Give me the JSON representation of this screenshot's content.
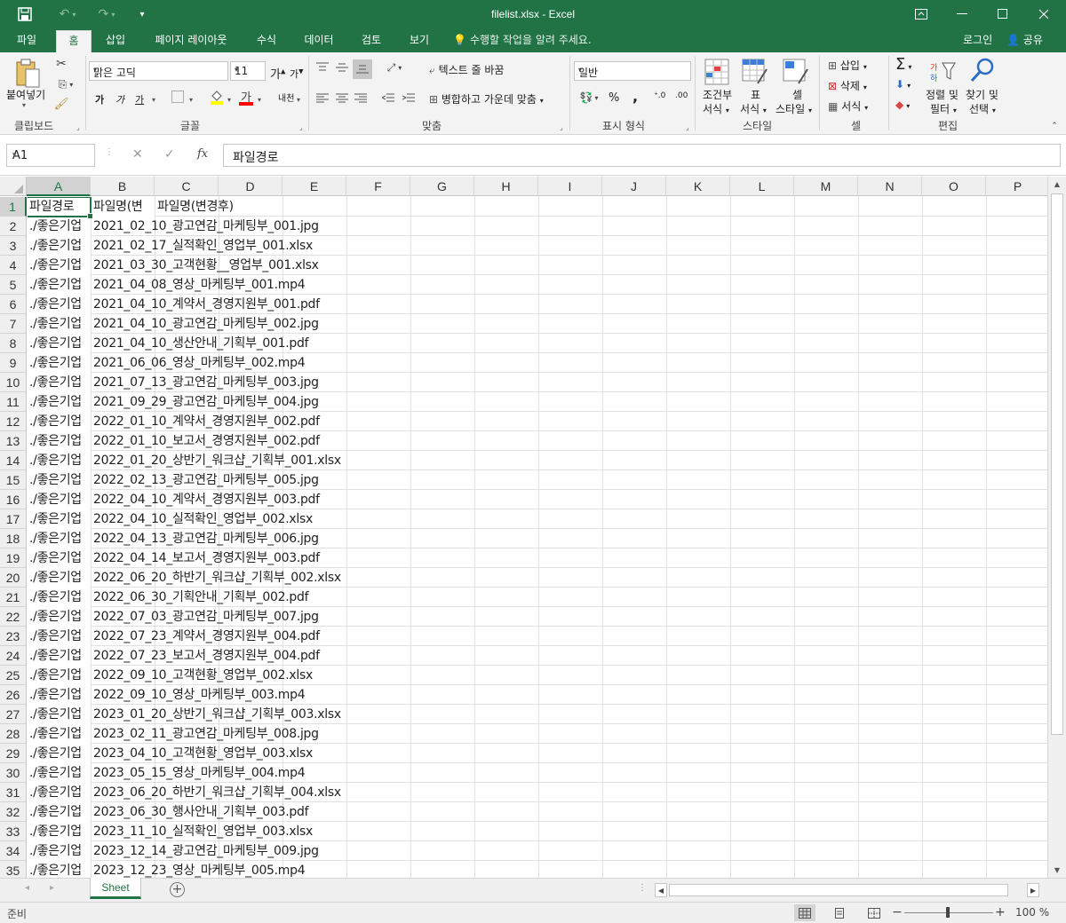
{
  "window": {
    "title": "filelist.xlsx - Excel",
    "minimize_icon": "minimize-icon",
    "maximize_icon": "maximize-icon",
    "close_icon": "close-icon"
  },
  "tabs": [
    "파일",
    "홈",
    "삽입",
    "페이지 레이아웃",
    "수식",
    "데이터",
    "검토",
    "보기"
  ],
  "active_tab": "홈",
  "tell_me": "수행할 작업을 알려 주세요.",
  "account": {
    "login": "로그인",
    "share": "공유"
  },
  "ribbon": {
    "clipboard": {
      "paste": "붙여넣기",
      "label": "클립보드"
    },
    "font": {
      "name": "맑은 고딕",
      "size": "11",
      "bold": "가",
      "italic": "가",
      "underline": "가",
      "grow": "가",
      "shrink": "가",
      "font_color": "가",
      "phonetic": "내천",
      "label": "글꼴"
    },
    "alignment": {
      "wrap": "텍스트 줄 바꿈",
      "merge": "병합하고 가운데 맞춤",
      "label": "맞춤"
    },
    "number": {
      "format": "일반",
      "percent": "%",
      "comma": ",",
      "label": "표시 형식"
    },
    "styles": {
      "conditional": "조건부",
      "conditional2": "서식",
      "table": "표",
      "table2": "서식",
      "cell": "셀",
      "cell2": "스타일",
      "label": "스타일"
    },
    "cells": {
      "insert": "삽입",
      "delete": "삭제",
      "format": "서식",
      "label": "셀"
    },
    "editing": {
      "sort": "정렬 및",
      "sort2": "필터",
      "find": "찾기 및",
      "find2": "선택",
      "label": "편집"
    }
  },
  "formula_bar": {
    "name_box": "A1",
    "fx": "fx",
    "content": "파일경로"
  },
  "columns": [
    "A",
    "B",
    "C",
    "D",
    "E",
    "F",
    "G",
    "H",
    "I",
    "J",
    "K",
    "L",
    "M",
    "N",
    "O",
    "P"
  ],
  "selected_column": "A",
  "header_row": {
    "a": "파일경로",
    "b": "파일명(변",
    "c": "파일명(변경후)"
  },
  "rows": [
    {
      "n": "2",
      "a": "./좋은기업",
      "b": "2021_02_10_광고연감_마케팅부_001.jpg"
    },
    {
      "n": "3",
      "a": "./좋은기업",
      "b": "2021_02_17_실적확인_영업부_001.xlsx"
    },
    {
      "n": "4",
      "a": "./좋은기업",
      "b": "2021_03_30_고객현황__영업부_001.xlsx"
    },
    {
      "n": "5",
      "a": "./좋은기업",
      "b": "2021_04_08_영상_마케팅부_001.mp4"
    },
    {
      "n": "6",
      "a": "./좋은기업",
      "b": "2021_04_10_계약서_경영지원부_001.pdf"
    },
    {
      "n": "7",
      "a": "./좋은기업",
      "b": "2021_04_10_광고연감_마케팅부_002.jpg"
    },
    {
      "n": "8",
      "a": "./좋은기업",
      "b": "2021_04_10_생산안내_기획부_001.pdf"
    },
    {
      "n": "9",
      "a": "./좋은기업",
      "b": "2021_06_06_영상_마케팅부_002.mp4"
    },
    {
      "n": "10",
      "a": "./좋은기업",
      "b": "2021_07_13_광고연감_마케팅부_003.jpg"
    },
    {
      "n": "11",
      "a": "./좋은기업",
      "b": "2021_09_29_광고연감_마케팅부_004.jpg"
    },
    {
      "n": "12",
      "a": "./좋은기업",
      "b": "2022_01_10_계약서_경영지원부_002.pdf"
    },
    {
      "n": "13",
      "a": "./좋은기업",
      "b": "2022_01_10_보고서_경영지원부_002.pdf"
    },
    {
      "n": "14",
      "a": "./좋은기업",
      "b": "2022_01_20_상반기_워크샵_기획부_001.xlsx"
    },
    {
      "n": "15",
      "a": "./좋은기업",
      "b": "2022_02_13_광고연감_마케팅부_005.jpg"
    },
    {
      "n": "16",
      "a": "./좋은기업",
      "b": "2022_04_10_계약서_경영지원부_003.pdf"
    },
    {
      "n": "17",
      "a": "./좋은기업",
      "b": "2022_04_10_실적확인_영업부_002.xlsx"
    },
    {
      "n": "18",
      "a": "./좋은기업",
      "b": "2022_04_13_광고연감_마케팅부_006.jpg"
    },
    {
      "n": "19",
      "a": "./좋은기업",
      "b": "2022_04_14_보고서_경영지원부_003.pdf"
    },
    {
      "n": "20",
      "a": "./좋은기업",
      "b": "2022_06_20_하반기_워크샵_기획부_002.xlsx"
    },
    {
      "n": "21",
      "a": "./좋은기업",
      "b": "2022_06_30_기획안내_기획부_002.pdf"
    },
    {
      "n": "22",
      "a": "./좋은기업",
      "b": "2022_07_03_광고연감_마케팅부_007.jpg"
    },
    {
      "n": "23",
      "a": "./좋은기업",
      "b": "2022_07_23_계약서_경영지원부_004.pdf"
    },
    {
      "n": "24",
      "a": "./좋은기업",
      "b": "2022_07_23_보고서_경영지원부_004.pdf"
    },
    {
      "n": "25",
      "a": "./좋은기업",
      "b": "2022_09_10_고객현황_영업부_002.xlsx"
    },
    {
      "n": "26",
      "a": "./좋은기업",
      "b": "2022_09_10_영상_마케팅부_003.mp4"
    },
    {
      "n": "27",
      "a": "./좋은기업",
      "b": "2023_01_20_상반기_워크샵_기획부_003.xlsx"
    },
    {
      "n": "28",
      "a": "./좋은기업",
      "b": "2023_02_11_광고연감_마케팅부_008.jpg"
    },
    {
      "n": "29",
      "a": "./좋은기업",
      "b": "2023_04_10_고객현황_영업부_003.xlsx"
    },
    {
      "n": "30",
      "a": "./좋은기업",
      "b": "2023_05_15_영상_마케팅부_004.mp4"
    },
    {
      "n": "31",
      "a": "./좋은기업",
      "b": "2023_06_20_하반기_워크샵_기획부_004.xlsx"
    },
    {
      "n": "32",
      "a": "./좋은기업",
      "b": "2023_06_30_행사안내_기획부_003.pdf"
    },
    {
      "n": "33",
      "a": "./좋은기업",
      "b": "2023_11_10_실적확인_영업부_003.xlsx"
    },
    {
      "n": "34",
      "a": "./좋은기업",
      "b": "2023_12_14_광고연감_마케팅부_009.jpg"
    },
    {
      "n": "35",
      "a": "./좋은기업",
      "b": "2023_12_23_영상_마케팅부_005.mp4"
    }
  ],
  "sheet_tab": "Sheet",
  "status": {
    "ready": "준비",
    "zoom": "100 %",
    "minus": "−",
    "plus": "+"
  }
}
